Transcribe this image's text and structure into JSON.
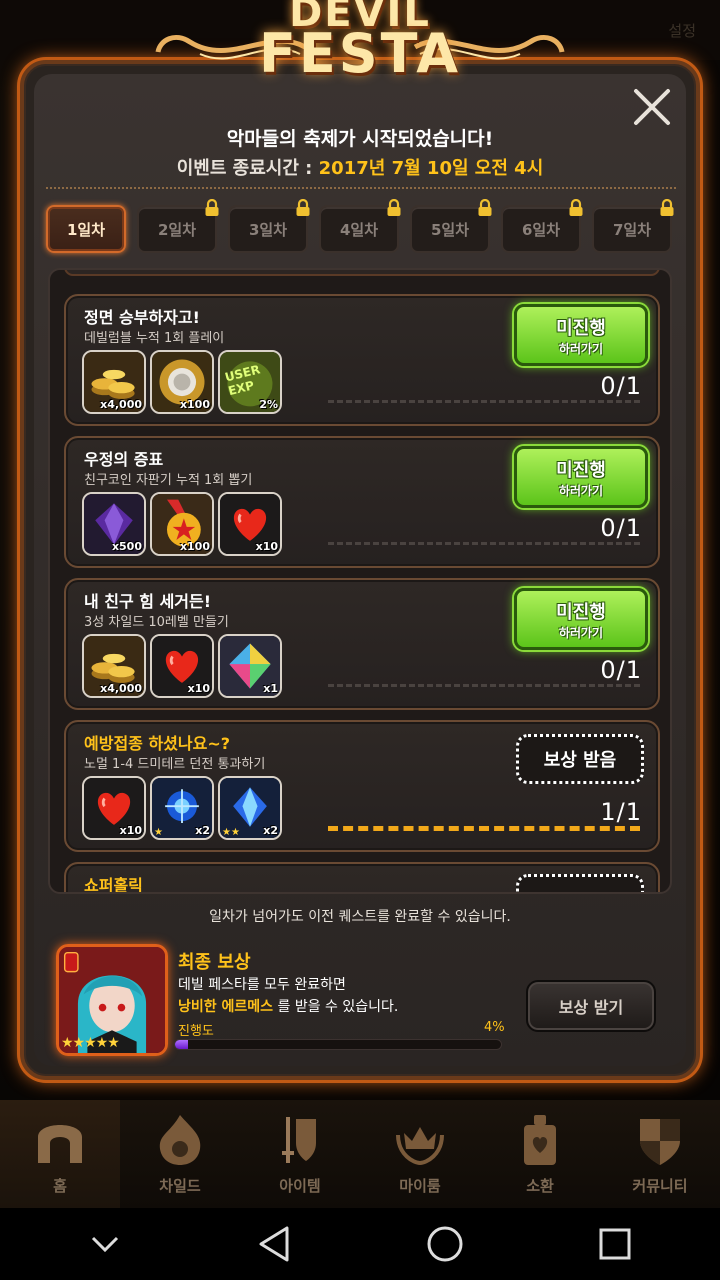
{
  "background": {
    "settings_label": "설정"
  },
  "event": {
    "logo_line1": "DEVIL",
    "logo_line2": "FESTA",
    "subtitle": "악마들의 축제가 시작되었습니다!",
    "end_label": "이벤트 종료시간 : ",
    "end_value": "2017년 7월 10일 오전 4시"
  },
  "tabs": [
    {
      "label": "1일차",
      "active": true,
      "locked": false
    },
    {
      "label": "2일차",
      "active": false,
      "locked": true
    },
    {
      "label": "3일차",
      "active": false,
      "locked": true
    },
    {
      "label": "4일차",
      "active": false,
      "locked": true
    },
    {
      "label": "5일차",
      "active": false,
      "locked": true
    },
    {
      "label": "6일차",
      "active": false,
      "locked": true
    },
    {
      "label": "7일차",
      "active": false,
      "locked": true
    }
  ],
  "quests": [
    {
      "title": "정면 승부하자고!",
      "desc": "데빌럼블 누적 1회 플레이",
      "rewards": [
        {
          "icon": "gold-coins-icon",
          "count": "x4,000"
        },
        {
          "icon": "silver-coin-icon",
          "count": "x100"
        },
        {
          "icon": "user-exp-icon",
          "count": "2%",
          "icon_text": "USER EXP"
        }
      ],
      "button_main": "미진행",
      "button_sub": "하러가기",
      "progress": "0/1"
    },
    {
      "title": "우정의 증표",
      "desc": "친구코인 자판기 누적 1회 뽑기",
      "rewards": [
        {
          "icon": "purple-gem-icon",
          "count": "x500"
        },
        {
          "icon": "friend-medal-icon",
          "count": "x100"
        },
        {
          "icon": "heart-icon",
          "count": "x10"
        }
      ],
      "button_main": "미진행",
      "button_sub": "하러가기",
      "progress": "0/1"
    },
    {
      "title": "내 친구 힘 세거든!",
      "desc": "3성 차일드 10레벨 만들기",
      "rewards": [
        {
          "icon": "gold-coins-icon",
          "count": "x4,000"
        },
        {
          "icon": "heart-icon",
          "count": "x10"
        },
        {
          "icon": "rainbow-crystal-icon",
          "count": "x1"
        }
      ],
      "button_main": "미진행",
      "button_sub": "하러가기",
      "progress": "0/1"
    },
    {
      "title": "예방접종 하셨나요~?",
      "desc": "노멀 1-4 드미테르 던전 통과하기",
      "rewards": [
        {
          "icon": "heart-icon",
          "count": "x10"
        },
        {
          "icon": "blue-orb-icon",
          "count": "x2",
          "stars": "★"
        },
        {
          "icon": "blue-crystal-icon",
          "count": "x2",
          "stars": "★★"
        }
      ],
      "button_main": "보상 받음",
      "progress": "1/1"
    },
    {
      "title": "쇼퍼홀릭"
    }
  ],
  "footer_note": "일차가 넘어가도 이전 퀘스트를 완료할 수 있습니다.",
  "final_reward": {
    "title": "최종 보상",
    "line1": "데빌 페스타를 모두 완료하면",
    "highlight": "낭비한 에르메스",
    "line2_suffix": " 를 받을 수 있습니다.",
    "progress_label": "진행도",
    "progress_pct": "4%",
    "progress_value": 0.04,
    "stars": "★★★★★",
    "button": "보상 받기"
  },
  "bottom_nav": [
    {
      "label": "홈",
      "icon": "home-arch-icon",
      "active": true
    },
    {
      "label": "차일드",
      "icon": "flame-eye-icon",
      "active": false
    },
    {
      "label": "아이템",
      "icon": "sword-shield-icon",
      "active": false
    },
    {
      "label": "마이룸",
      "icon": "crown-wreath-icon",
      "active": false
    },
    {
      "label": "소환",
      "icon": "summon-card-icon",
      "active": false
    },
    {
      "label": "커뮤니티",
      "icon": "community-shield-icon",
      "active": false
    }
  ],
  "colors": {
    "accent_gold": "#ffc21a",
    "go_green": "#6cd020",
    "panel_orange": "#e0601a"
  }
}
